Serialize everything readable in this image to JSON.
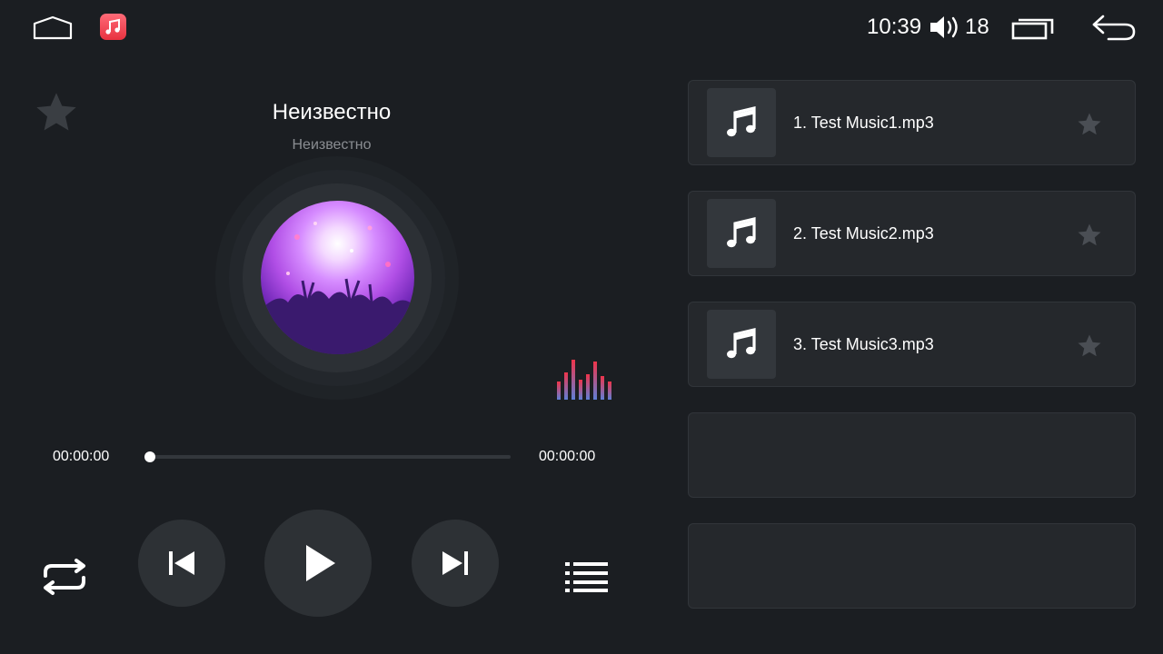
{
  "status_bar": {
    "home_icon": "home-icon",
    "app_icon": "music-app-icon",
    "time": "10:39",
    "volume_icon": "volume-icon",
    "volume": "18",
    "recents_icon": "recents-icon",
    "back_icon": "back-icon"
  },
  "player": {
    "title": "Неизвестно",
    "artist": "Неизвестно",
    "elapsed": "00:00:00",
    "duration": "00:00:00",
    "progress": 0,
    "favorite_icon": "star-icon"
  },
  "controls": {
    "repeat_icon": "repeat-icon",
    "prev_icon": "skip-previous-icon",
    "play_icon": "play-icon",
    "next_icon": "skip-next-icon",
    "playlist_icon": "list-icon",
    "equalizer_icon": "equalizer-icon"
  },
  "playlist": [
    {
      "label": "1. Test Music1.mp3",
      "icon": "music-note-icon",
      "favorite_icon": "star-icon"
    },
    {
      "label": "2. Test Music2.mp3",
      "icon": "music-note-icon",
      "favorite_icon": "star-icon"
    },
    {
      "label": "3. Test Music3.mp3",
      "icon": "music-note-icon",
      "favorite_icon": "star-icon"
    },
    {
      "label": "",
      "icon": "",
      "favorite_icon": ""
    },
    {
      "label": "",
      "icon": "",
      "favorite_icon": ""
    }
  ],
  "colors": {
    "background": "#1b1e22",
    "panel": "#25282c",
    "accent_red": "#e8323f",
    "eq_blue": "#5f7fd6"
  }
}
